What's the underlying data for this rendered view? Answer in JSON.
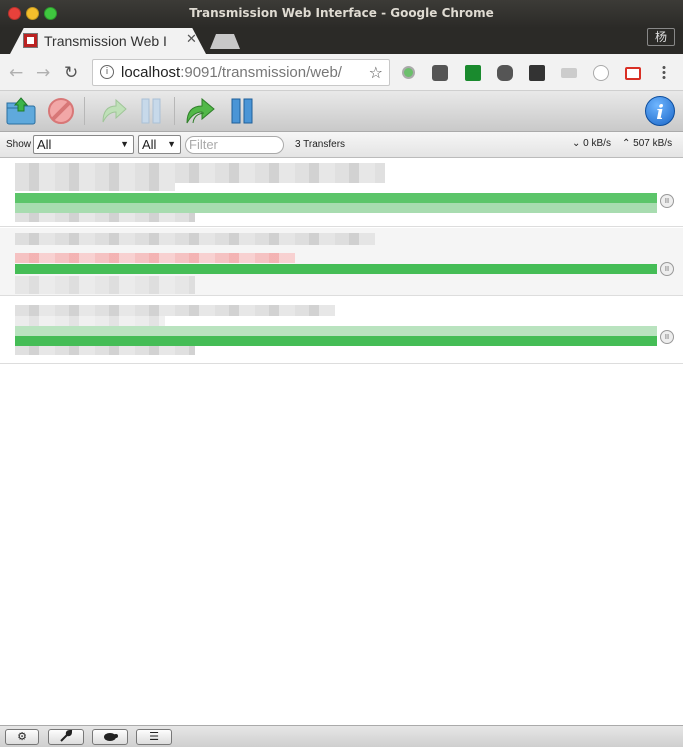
{
  "window": {
    "title": "Transmission Web Interface - Google Chrome"
  },
  "tab": {
    "title": "Transmission Web I",
    "close_glyph": "✕"
  },
  "profile": {
    "label": "杨"
  },
  "address": {
    "host": "localhost",
    "rest": ":9091/transmission/web/"
  },
  "icons": {
    "back": "←",
    "forward": "→",
    "reload": "↻",
    "info": "i",
    "star": "☆",
    "pause_small": "II"
  },
  "extensions": [
    {
      "name": "green-dot-extension-icon",
      "color": "#4caf50"
    },
    {
      "name": "pocket-extension-icon",
      "color": "#555555"
    },
    {
      "name": "v-extension-icon",
      "color": "#1a8a2e"
    },
    {
      "name": "evernote-extension-icon",
      "color": "#444444"
    },
    {
      "name": "arrow-extension-icon",
      "color": "#333333"
    },
    {
      "name": "hd-extension-icon",
      "color": "#bbbbbb"
    },
    {
      "name": "circle-extension-icon",
      "color": "#cccccc"
    },
    {
      "name": "gmail-extension-icon",
      "color": "#d93025"
    },
    {
      "name": "chrome-menu-icon",
      "color": "#555555"
    }
  ],
  "filter": {
    "show_label": "Show",
    "state_select": "All",
    "tracker_select": "All",
    "placeholder": "Filter",
    "transfer_count": "3 Transfers",
    "down_speed": "0 kB/s",
    "up_speed": "507 kB/s"
  },
  "torrents": [
    {
      "progress": 1.0,
      "status": "seeding"
    },
    {
      "progress": 1.0,
      "status": "seeding"
    },
    {
      "progress": 1.0,
      "status": "seeding"
    }
  ],
  "bottom": {
    "settings_icon": "⚙",
    "prefs_icon": "wrench",
    "turtle_icon": "turtle",
    "compact_icon": "☰"
  }
}
